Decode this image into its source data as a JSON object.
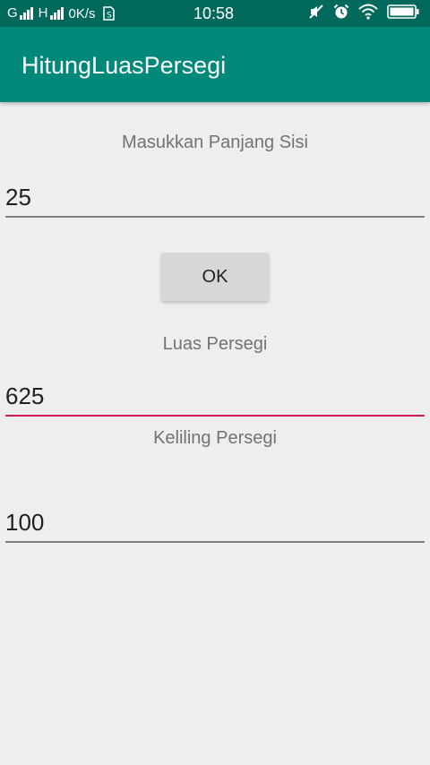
{
  "status_bar": {
    "sim1_label": "G",
    "sim2_label": "H",
    "speed": "0K/s",
    "time": "10:58",
    "icons": [
      "sim-card-icon",
      "mute-icon",
      "alarm-icon",
      "wifi-icon",
      "battery-icon"
    ]
  },
  "app_bar": {
    "title": "HitungLuasPersegi",
    "color": "#00897b",
    "status_color": "#00695c"
  },
  "form": {
    "sisi_label": "Masukkan Panjang Sisi",
    "sisi_value": "25",
    "ok_label": "OK",
    "luas_label": "Luas Persegi",
    "luas_value": "625",
    "keliling_label": "Keliling Persegi",
    "keliling_value": "100",
    "accent_color": "#d81b60"
  }
}
